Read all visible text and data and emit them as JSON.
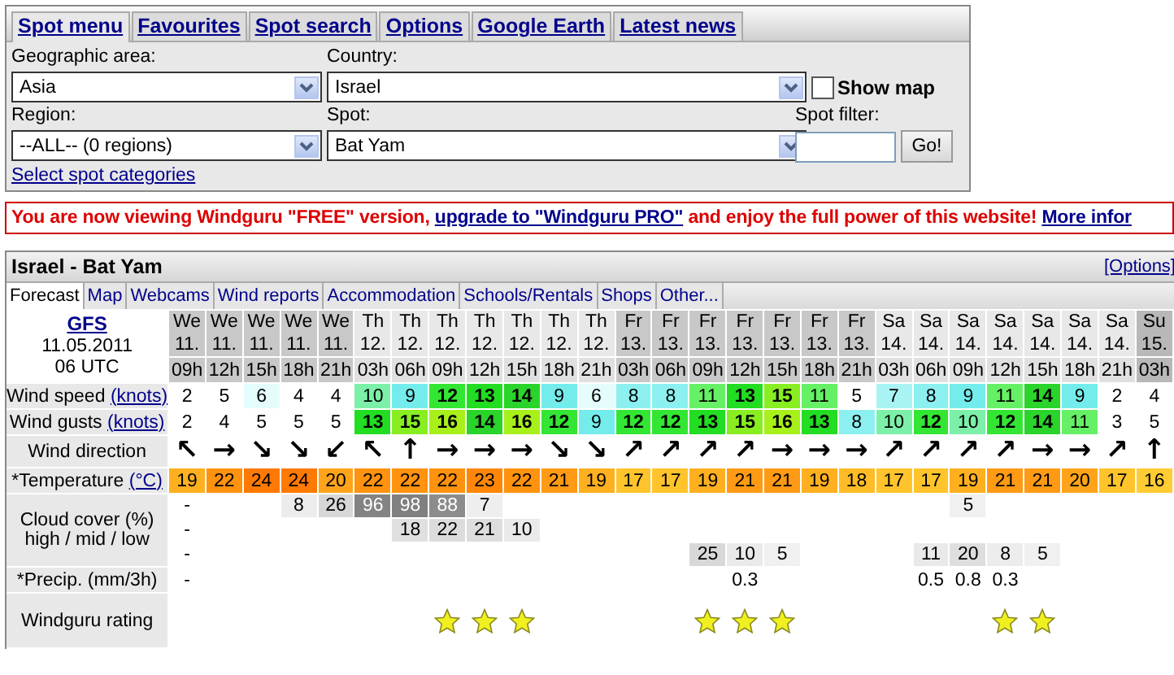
{
  "top_tabs": [
    {
      "label": "Spot menu",
      "selected": true
    },
    {
      "label": "Favourites",
      "selected": false
    },
    {
      "label": "Spot search",
      "selected": false
    },
    {
      "label": "Options",
      "selected": false
    },
    {
      "label": "Google Earth",
      "selected": false
    },
    {
      "label": "Latest news",
      "selected": false
    }
  ],
  "spot_form": {
    "geographic_area": {
      "label": "Geographic area:",
      "value": "Asia"
    },
    "country": {
      "label": "Country:",
      "value": "Israel"
    },
    "show_map": {
      "label": "Show map",
      "checked": false
    },
    "region": {
      "label": "Region:",
      "value": "--ALL-- (0 regions)"
    },
    "spot": {
      "label": "Spot:",
      "value": "Bat Yam"
    },
    "spot_filter": {
      "label": "Spot filter:"
    },
    "go_button": "Go!",
    "categories_link": "Select spot categories"
  },
  "banner": {
    "text_before": "You are now viewing Windguru \"FREE\" version, ",
    "upgrade_link": "upgrade to \"Windguru PRO\"",
    "text_after": " and enjoy the full power of this website! ",
    "more_link": "More infor"
  },
  "forecast": {
    "title": "Israel - Bat Yam",
    "options_link": "[Options]",
    "tabs": [
      {
        "label": "Forecast",
        "selected": true
      },
      {
        "label": "Map",
        "selected": false
      },
      {
        "label": "Webcams",
        "selected": false
      },
      {
        "label": "Wind reports",
        "selected": false
      },
      {
        "label": "Accommodation",
        "selected": false
      },
      {
        "label": "Schools/Rentals",
        "selected": false
      },
      {
        "label": "Shops",
        "selected": false
      },
      {
        "label": "Other...",
        "selected": false
      }
    ],
    "model": "GFS",
    "model_date": "11.05.2011",
    "model_run": "06 UTC",
    "row_labels": {
      "wind_speed": {
        "label": "Wind speed",
        "unit_link": "(knots)"
      },
      "wind_gusts": {
        "label": "Wind gusts",
        "unit_link": "(knots)"
      },
      "wind_direction": {
        "label": "Wind direction"
      },
      "temperature": {
        "label": "*Temperature",
        "unit_link": "(°C)"
      },
      "cloud_cover": {
        "label": "Cloud cover (%)",
        "sublabel": "high / mid / low"
      },
      "precipitation": {
        "label": "*Precip. (mm/3h)"
      },
      "rating": {
        "label": "Windguru rating"
      }
    },
    "days": [
      {
        "columns": [
          {
            "day": "We",
            "date": "11.",
            "hour": "09h",
            "speed": "2",
            "gust": "2",
            "direction": "↖",
            "temp": "19",
            "cloud_high": "-",
            "cloud_mid": "-",
            "cloud_low": "-",
            "precip": "-",
            "rated": false
          },
          {
            "day": "We",
            "date": "11.",
            "hour": "12h",
            "speed": "5",
            "gust": "4",
            "direction": "→",
            "temp": "22",
            "rated": false
          },
          {
            "day": "We",
            "date": "11.",
            "hour": "15h",
            "speed": "6",
            "gust": "5",
            "direction": "↘",
            "temp": "24",
            "rated": false
          },
          {
            "day": "We",
            "date": "11.",
            "hour": "18h",
            "speed": "4",
            "gust": "5",
            "direction": "↘",
            "temp": "24",
            "cloud_high": "8",
            "rated": false
          },
          {
            "day": "We",
            "date": "11.",
            "hour": "21h",
            "speed": "4",
            "gust": "5",
            "direction": "↙",
            "temp": "20",
            "cloud_high": "26",
            "rated": false
          }
        ]
      },
      {
        "columns": [
          {
            "day": "Th",
            "date": "12.",
            "hour": "03h",
            "speed": "10",
            "gust": "13",
            "direction": "↖",
            "temp": "22",
            "cloud_high": "96",
            "rated": false
          },
          {
            "day": "Th",
            "date": "12.",
            "hour": "06h",
            "speed": "9",
            "gust": "15",
            "direction": "↑",
            "temp": "22",
            "cloud_high": "98",
            "cloud_mid": "18",
            "rated": false
          },
          {
            "day": "Th",
            "date": "12.",
            "hour": "09h",
            "speed": "12",
            "gust": "16",
            "direction": "→",
            "temp": "22",
            "cloud_high": "88",
            "cloud_mid": "22",
            "rated": true
          },
          {
            "day": "Th",
            "date": "12.",
            "hour": "12h",
            "speed": "13",
            "gust": "14",
            "direction": "→",
            "temp": "23",
            "cloud_high": "7",
            "cloud_mid": "21",
            "rated": true
          },
          {
            "day": "Th",
            "date": "12.",
            "hour": "15h",
            "speed": "14",
            "gust": "16",
            "direction": "→",
            "temp": "22",
            "cloud_mid": "10",
            "rated": true
          },
          {
            "day": "Th",
            "date": "12.",
            "hour": "18h",
            "speed": "9",
            "gust": "12",
            "direction": "↘",
            "temp": "21",
            "rated": false
          },
          {
            "day": "Th",
            "date": "12.",
            "hour": "21h",
            "speed": "6",
            "gust": "9",
            "direction": "↘",
            "temp": "19",
            "rated": false
          }
        ]
      },
      {
        "columns": [
          {
            "day": "Fr",
            "date": "13.",
            "hour": "03h",
            "speed": "8",
            "gust": "12",
            "direction": "↗",
            "temp": "17",
            "rated": false
          },
          {
            "day": "Fr",
            "date": "13.",
            "hour": "06h",
            "speed": "8",
            "gust": "12",
            "direction": "↗",
            "temp": "17",
            "rated": false
          },
          {
            "day": "Fr",
            "date": "13.",
            "hour": "09h",
            "speed": "11",
            "gust": "13",
            "direction": "↗",
            "temp": "19",
            "cloud_low": "25",
            "rated": true
          },
          {
            "day": "Fr",
            "date": "13.",
            "hour": "12h",
            "speed": "13",
            "gust": "15",
            "direction": "↗",
            "temp": "21",
            "cloud_low": "10",
            "precip": "0.3",
            "rated": true
          },
          {
            "day": "Fr",
            "date": "13.",
            "hour": "15h",
            "speed": "15",
            "gust": "16",
            "direction": "→",
            "temp": "21",
            "cloud_low": "5",
            "rated": true
          },
          {
            "day": "Fr",
            "date": "13.",
            "hour": "18h",
            "speed": "11",
            "gust": "13",
            "direction": "→",
            "temp": "19",
            "rated": false
          },
          {
            "day": "Fr",
            "date": "13.",
            "hour": "21h",
            "speed": "5",
            "gust": "8",
            "direction": "→",
            "temp": "18",
            "rated": false
          }
        ]
      },
      {
        "columns": [
          {
            "day": "Sa",
            "date": "14.",
            "hour": "03h",
            "speed": "7",
            "gust": "10",
            "direction": "↗",
            "temp": "17",
            "rated": false
          },
          {
            "day": "Sa",
            "date": "14.",
            "hour": "06h",
            "speed": "8",
            "gust": "12",
            "direction": "↗",
            "temp": "17",
            "cloud_low": "11",
            "precip": "0.5",
            "rated": false
          },
          {
            "day": "Sa",
            "date": "14.",
            "hour": "09h",
            "speed": "9",
            "gust": "10",
            "direction": "↗",
            "temp": "19",
            "cloud_high": "5",
            "cloud_low": "20",
            "precip": "0.8",
            "rated": false
          },
          {
            "day": "Sa",
            "date": "14.",
            "hour": "12h",
            "speed": "11",
            "gust": "12",
            "direction": "↗",
            "temp": "21",
            "cloud_low": "8",
            "precip": "0.3",
            "rated": true
          },
          {
            "day": "Sa",
            "date": "14.",
            "hour": "15h",
            "speed": "14",
            "gust": "14",
            "direction": "→",
            "temp": "21",
            "cloud_low": "5",
            "rated": true
          },
          {
            "day": "Sa",
            "date": "14.",
            "hour": "18h",
            "speed": "9",
            "gust": "11",
            "direction": "→",
            "temp": "20",
            "rated": false
          },
          {
            "day": "Sa",
            "date": "14.",
            "hour": "21h",
            "speed": "2",
            "gust": "3",
            "direction": "↗",
            "temp": "17",
            "rated": false
          }
        ]
      },
      {
        "columns": [
          {
            "day": "Su",
            "date": "15.",
            "hour": "03h",
            "speed": "4",
            "gust": "5",
            "direction": "↑",
            "temp": "16",
            "rated": false
          }
        ]
      }
    ]
  }
}
